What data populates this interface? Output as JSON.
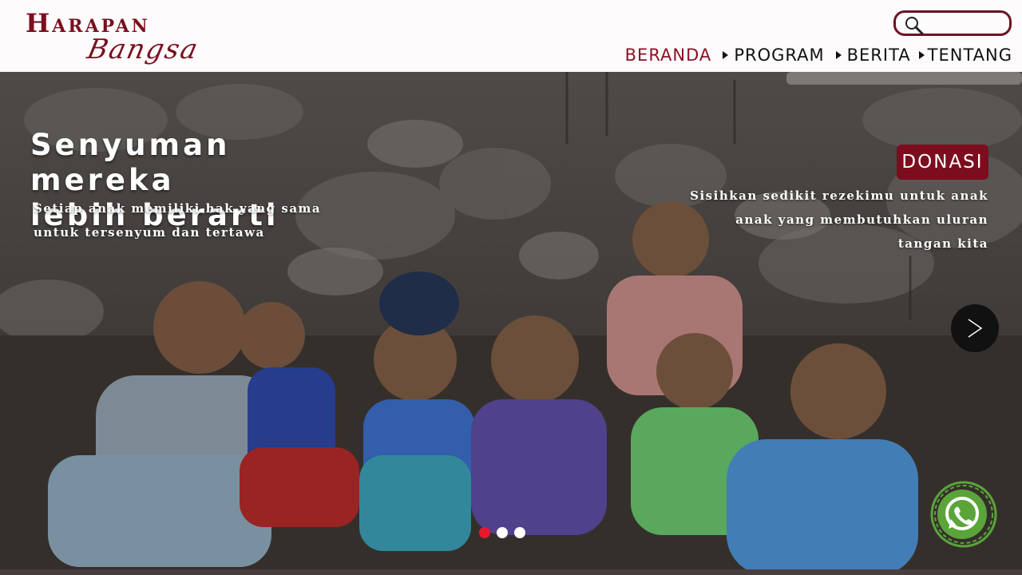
{
  "brand": {
    "line1": "Harapan",
    "line2": "Bangsa"
  },
  "search": {
    "value": "",
    "placeholder": ""
  },
  "nav": {
    "items": [
      {
        "label": "BERANDA",
        "active": true
      },
      {
        "label": "PROGRAM",
        "active": false
      },
      {
        "label": "BERITA",
        "active": false
      },
      {
        "label": "TENTANG",
        "active": false
      }
    ]
  },
  "hero": {
    "title_line1": "Senyuman mereka",
    "title_line2": "lebih berarti",
    "subtitle_line1": "Setiap anak memiliki hak yang sama",
    "subtitle_line2": "untuk tersenyum dan tertawa",
    "donate_label": "DONASI",
    "donate_line1": "Sisihkan sedikit rezekimu untuk anak",
    "donate_line2": "anak yang membutuhkan uluran",
    "donate_line3": "tangan kita"
  },
  "carousel": {
    "slide_count": 3,
    "active_index": 0
  },
  "colors": {
    "brand": "#7a0f1e",
    "donate_button": "#7c0d1e",
    "active_dot": "#e8182f",
    "whatsapp": "#5aa43a"
  },
  "icons": {
    "search": "search-icon",
    "next": "chevron-right-icon",
    "whatsapp": "whatsapp-icon"
  }
}
